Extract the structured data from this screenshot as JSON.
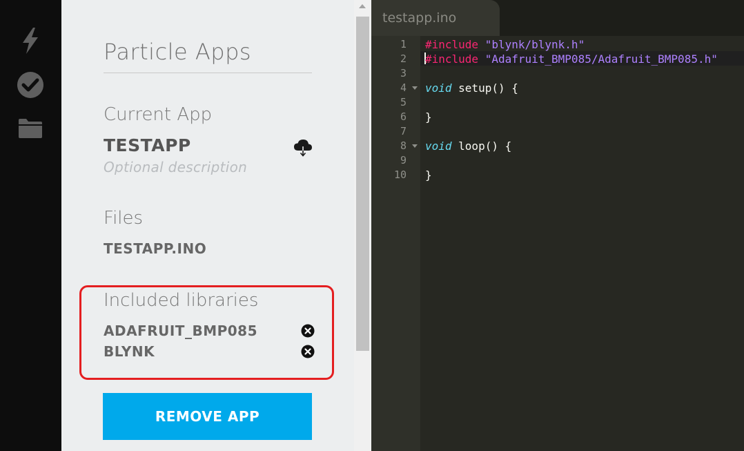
{
  "rail": {
    "icons": [
      {
        "name": "flash-icon"
      },
      {
        "name": "verify-icon"
      },
      {
        "name": "folder-icon"
      }
    ]
  },
  "panel": {
    "title": "Particle Apps",
    "current_app_label": "Current App",
    "app_name": "TESTAPP",
    "app_description_placeholder": "Optional description",
    "files_label": "Files",
    "files": [
      "TESTAPP.INO"
    ],
    "libraries_label": "Included libraries",
    "libraries": [
      "ADAFRUIT_BMP085",
      "BLYNK"
    ],
    "remove_button_label": "REMOVE APP"
  },
  "editor": {
    "tab_title": "testapp.ino",
    "line_numbers": [
      "1",
      "2",
      "3",
      "4",
      "5",
      "6",
      "7",
      "8",
      "9",
      "10"
    ],
    "code": {
      "l1_directive": "#include",
      "l1_string": "\"blynk/blynk.h\"",
      "l2_directive": "#include",
      "l2_string": "\"Adafruit_BMP085/Adafruit_BMP085.h\"",
      "l4_type": "void",
      "l4_rest": " setup() {",
      "l6": "}",
      "l8_type": "void",
      "l8_rest": " loop() {",
      "l10": "}"
    }
  },
  "colors": {
    "accent": "#00a9eb",
    "highlight_border": "#e41e20",
    "editor_bg": "#272822",
    "preprocessor": "#f92672",
    "string": "#ae81ff",
    "type": "#66d9ef"
  }
}
